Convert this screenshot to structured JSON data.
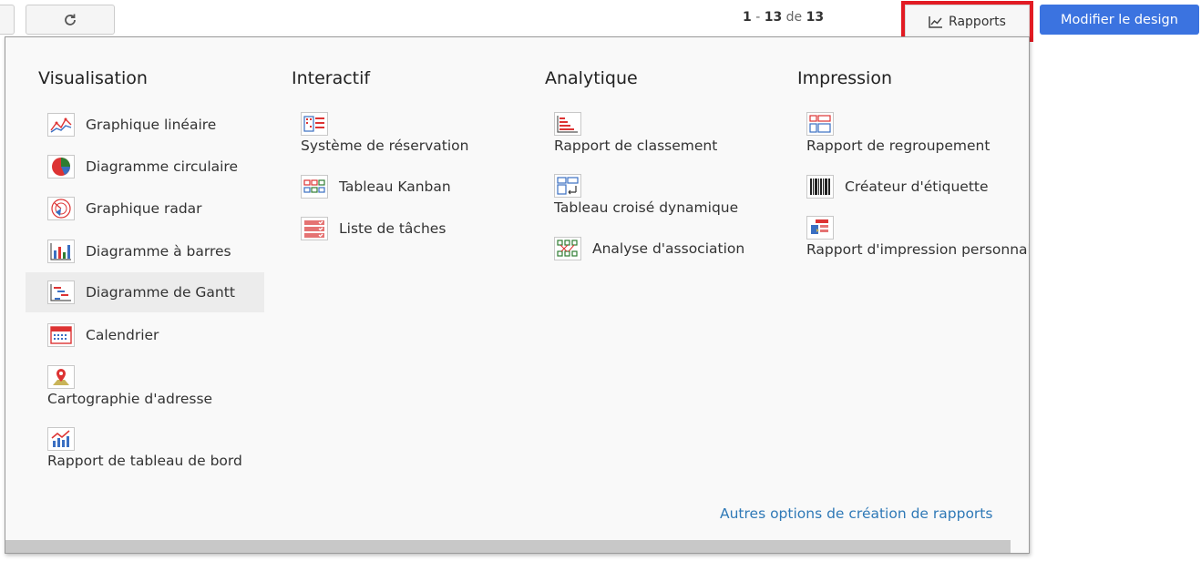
{
  "toolbar": {
    "pagination": {
      "start": "1",
      "sep": "-",
      "end": "13",
      "of": "de",
      "total": "13"
    },
    "reports_label": "Rapports",
    "design_label": "Modifier le design"
  },
  "menu": {
    "columns": [
      {
        "title": "Visualisation",
        "items": [
          {
            "label": "Graphique linéaire",
            "icon": "line-chart-icon"
          },
          {
            "label": "Diagramme circulaire",
            "icon": "pie-chart-icon"
          },
          {
            "label": "Graphique radar",
            "icon": "radar-chart-icon"
          },
          {
            "label": "Diagramme à barres",
            "icon": "bar-chart-icon"
          },
          {
            "label": "Diagramme de Gantt",
            "icon": "gantt-chart-icon"
          },
          {
            "label": "Calendrier",
            "icon": "calendar-icon"
          },
          {
            "label": "Cartographie d'adresse",
            "icon": "map-pin-icon"
          },
          {
            "label": "Rapport de tableau de bord",
            "icon": "dashboard-icon"
          }
        ]
      },
      {
        "title": "Interactif",
        "items": [
          {
            "label": "Système de réservation",
            "icon": "reservation-icon"
          },
          {
            "label": "Tableau Kanban",
            "icon": "kanban-icon"
          },
          {
            "label": "Liste de tâches",
            "icon": "task-list-icon"
          }
        ]
      },
      {
        "title": "Analytique",
        "items": [
          {
            "label": "Rapport de classement",
            "icon": "ranking-icon"
          },
          {
            "label": "Tableau croisé dynamique",
            "icon": "pivot-table-icon"
          },
          {
            "label": "Analyse d'association",
            "icon": "association-icon"
          }
        ]
      },
      {
        "title": "Impression",
        "items": [
          {
            "label": "Rapport de regroupement",
            "icon": "grouping-icon"
          },
          {
            "label": "Créateur d'étiquette",
            "icon": "barcode-icon"
          },
          {
            "label": "Rapport d'impression personnal",
            "icon": "custom-print-icon"
          }
        ]
      }
    ],
    "more_link": "Autres options de création de rapports"
  }
}
